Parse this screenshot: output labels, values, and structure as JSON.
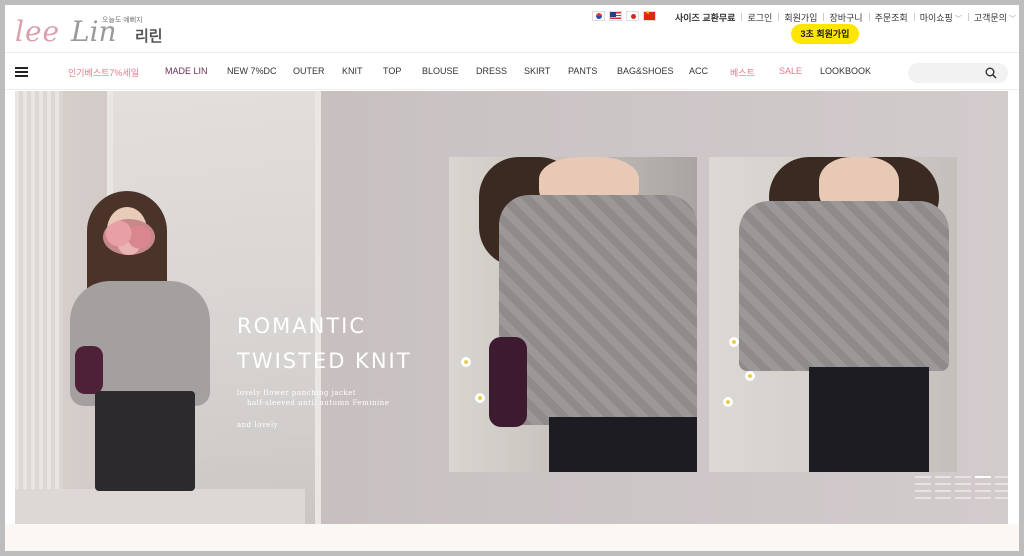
{
  "brand": {
    "logo_script": "lee",
    "logo_script2": "Lin",
    "logo_korean": "리린",
    "logo_tagline": "오늘도 예뻐지"
  },
  "colors": {
    "accent_pink": "#e27a8c",
    "accent_purple": "#6a2c57",
    "join_badge": "#ffe600"
  },
  "flags": [
    "korea-flag-icon",
    "usa-flag-icon",
    "japan-flag-icon",
    "china-flag-icon"
  ],
  "top_links": {
    "size_exchange": "사이즈 교환무료",
    "login": "로그인",
    "signup": "회원가입",
    "cart": "장바구니",
    "order_lookup": "주문조회",
    "my_shopping": "마이쇼핑",
    "customer_service": "고객문의"
  },
  "join_badge": "3초 회원가입",
  "nav": {
    "items": [
      {
        "label": "인기베스트7%세일"
      },
      {
        "label": "MADE LIN"
      },
      {
        "label": "NEW 7%DC"
      },
      {
        "label": "OUTER"
      },
      {
        "label": "KNIT"
      },
      {
        "label": "TOP"
      },
      {
        "label": "BLOUSE"
      },
      {
        "label": "DRESS"
      },
      {
        "label": "SKIRT"
      },
      {
        "label": "PANTS"
      },
      {
        "label": "BAG&SHOES"
      },
      {
        "label": "ACC"
      },
      {
        "label": "베스트"
      },
      {
        "label": "SALE"
      },
      {
        "label": "LOOKBOOK"
      }
    ]
  },
  "search": {
    "placeholder": ""
  },
  "hero": {
    "title_line1": "ROMANTIC",
    "title_line2": "TWISTED KNIT",
    "sub_line1": "lovely flower punching jacket",
    "sub_line2": "half-sleeved until autumn Feminine",
    "sub_line3": "and lovely"
  }
}
